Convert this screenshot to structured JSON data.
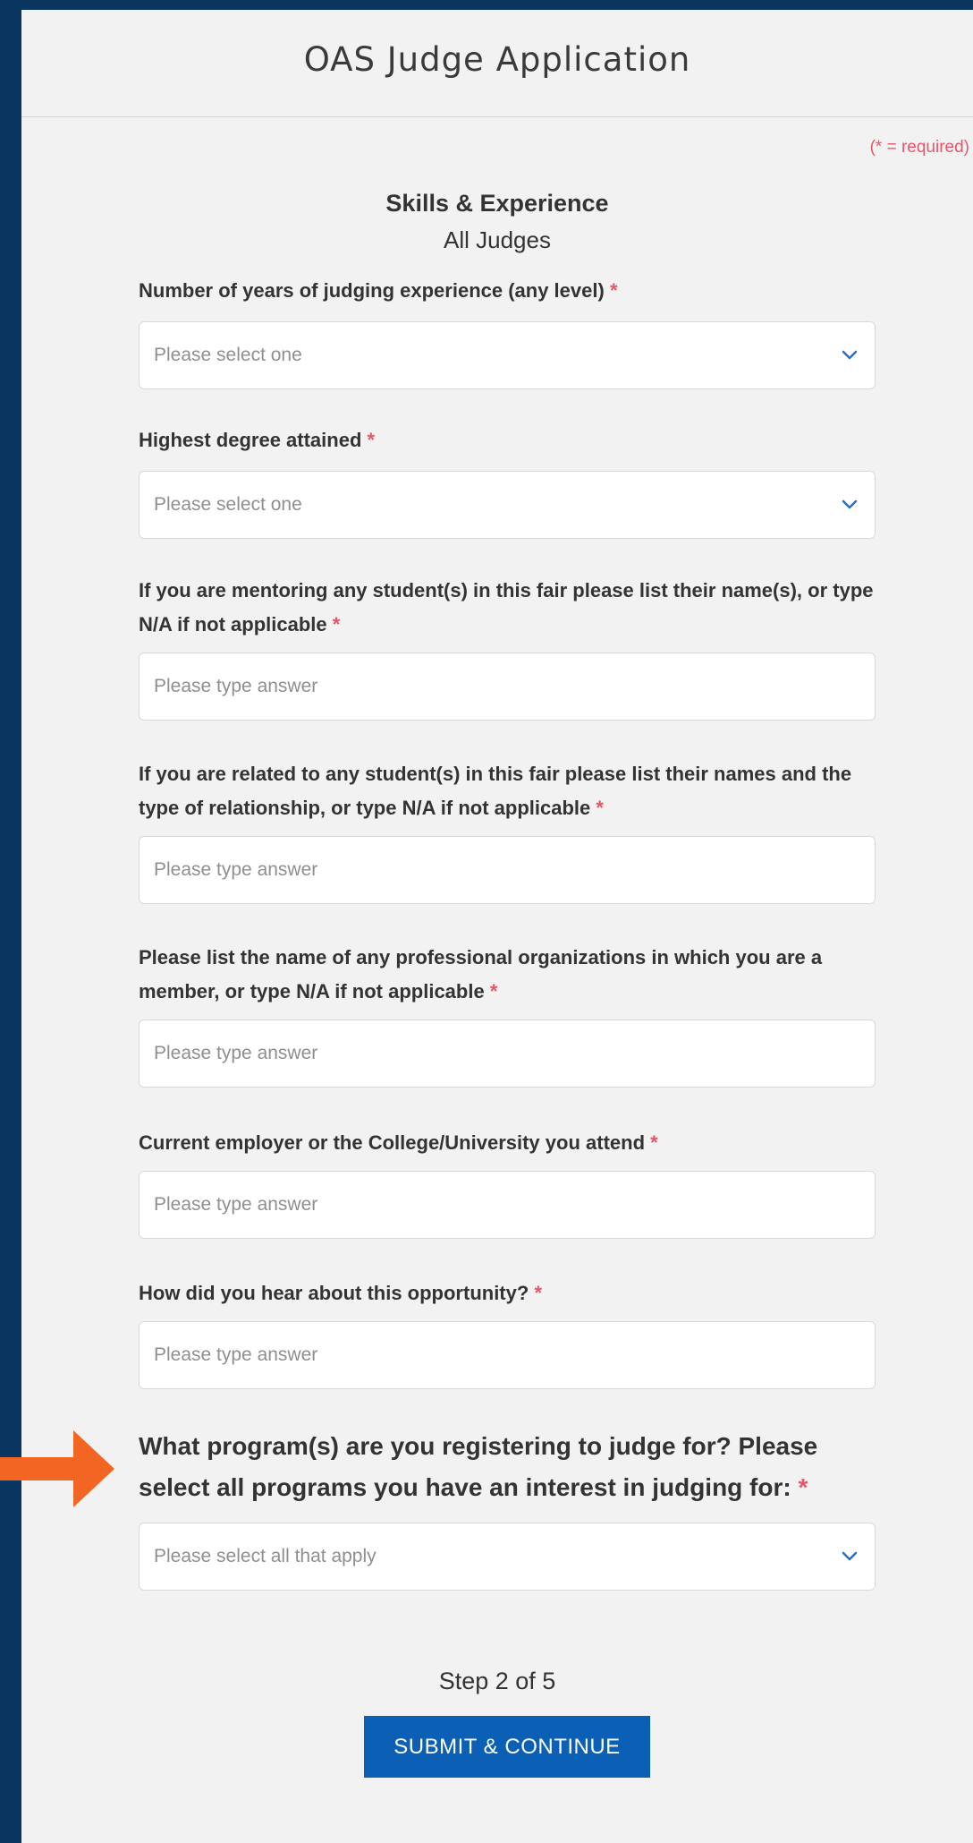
{
  "header": {
    "title": "OAS Judge Application"
  },
  "required_note": "(* = required)",
  "section": {
    "title": "Skills & Experience",
    "subtitle": "All Judges"
  },
  "required_marker": "*",
  "fields": [
    {
      "label": "Number of years of judging experience (any level)",
      "type": "select",
      "placeholder": "Please select one"
    },
    {
      "label": "Highest degree attained",
      "type": "select",
      "placeholder": "Please select one"
    },
    {
      "label": "If you are mentoring any student(s) in this fair please list their name(s), or type N/A if not applicable",
      "type": "text",
      "placeholder": "Please type answer"
    },
    {
      "label": "If you are related to any student(s) in this fair please list their names and the type of relationship, or type N/A if not applicable",
      "type": "text",
      "placeholder": "Please type answer"
    },
    {
      "label": "Please list the name of any professional organizations in which you are a member, or type N/A if not applicable",
      "type": "text",
      "placeholder": "Please type answer"
    },
    {
      "label": "Current employer or the College/University you attend",
      "type": "text",
      "placeholder": "Please type answer"
    },
    {
      "label": "How did you hear about this opportunity?",
      "type": "text",
      "placeholder": "Please type answer"
    },
    {
      "label": "What program(s) are you registering to judge for? Please select all programs you have an interest in judging for:",
      "type": "multiselect",
      "placeholder": "Please select all that apply"
    }
  ],
  "footer": {
    "step": "Step 2 of 5",
    "submit_label": "SUBMIT & CONTINUE"
  },
  "icons": {
    "dropdown": "chevron-down-icon",
    "annotation": "arrow-right-icon"
  },
  "colors": {
    "background": "#0a3561",
    "panel": "#f2f2f2",
    "accent": "#0b60b5",
    "required": "#e8556a",
    "annotation_arrow": "#f26522"
  }
}
